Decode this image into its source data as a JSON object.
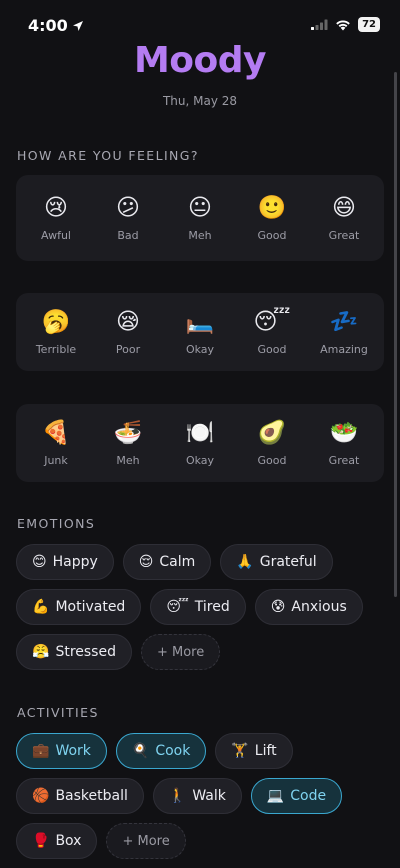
{
  "status": {
    "time": "4:00",
    "battery": "72"
  },
  "app": {
    "title": "Moody",
    "date": "Thu, May 28"
  },
  "feeling": {
    "heading": "HOW ARE YOU FEELING?",
    "mood": [
      {
        "icon": "😢",
        "label": "Awful"
      },
      {
        "icon": "😕",
        "label": "Bad"
      },
      {
        "icon": "😐",
        "label": "Meh"
      },
      {
        "icon": "🙂",
        "label": "Good"
      },
      {
        "icon": "😄",
        "label": "Great"
      }
    ],
    "sleep": [
      {
        "icon": "🥱",
        "label": "Terrible"
      },
      {
        "icon": "😪",
        "label": "Poor"
      },
      {
        "icon": "🛏️",
        "label": "Okay"
      },
      {
        "icon": "😴",
        "label": "Good"
      },
      {
        "icon": "💤",
        "label": "Amazing"
      }
    ],
    "food": [
      {
        "icon": "🍕",
        "label": "Junk"
      },
      {
        "icon": "🍜",
        "label": "Meh"
      },
      {
        "icon": "🍽️",
        "label": "Okay"
      },
      {
        "icon": "🥑",
        "label": "Good"
      },
      {
        "icon": "🥗",
        "label": "Great"
      }
    ]
  },
  "emotions": {
    "heading": "EMOTIONS",
    "items": [
      {
        "icon": "😊",
        "label": "Happy"
      },
      {
        "icon": "😌",
        "label": "Calm"
      },
      {
        "icon": "🙏",
        "label": "Grateful"
      },
      {
        "icon": "💪",
        "label": "Motivated"
      },
      {
        "icon": "😴",
        "label": "Tired"
      },
      {
        "icon": "😰",
        "label": "Anxious"
      },
      {
        "icon": "😤",
        "label": "Stressed"
      }
    ],
    "more": "+ More"
  },
  "activities": {
    "heading": "ACTIVITIES",
    "items": [
      {
        "icon": "💼",
        "label": "Work",
        "selected": true
      },
      {
        "icon": "🍳",
        "label": "Cook",
        "selected": true
      },
      {
        "icon": "🏋️",
        "label": "Lift",
        "selected": false
      },
      {
        "icon": "🏀",
        "label": "Basketball",
        "selected": false
      },
      {
        "icon": "🚶",
        "label": "Walk",
        "selected": false
      },
      {
        "icon": "💻",
        "label": "Code",
        "selected": true
      },
      {
        "icon": "🥊",
        "label": "Box",
        "selected": false
      }
    ],
    "more": "+ More"
  },
  "colors": {
    "background": "#111114",
    "card": "#1c1c21",
    "title_accent": "#b47cf2",
    "selected_border": "#3aa7cf",
    "selected_text": "#7fd3f0"
  }
}
